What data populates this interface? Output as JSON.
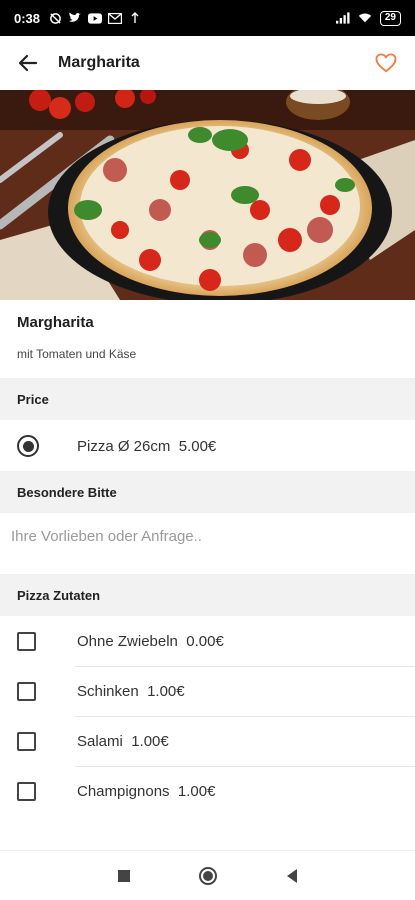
{
  "status_bar": {
    "time": "0:38",
    "battery": "29"
  },
  "app_bar": {
    "title": "Margharita"
  },
  "product": {
    "name": "Margharita",
    "description": "mit Tomaten und Käse"
  },
  "price_section": {
    "title": "Price",
    "option": {
      "label": "Pizza Ø 26cm",
      "price": "5.00€",
      "selected": true
    }
  },
  "request_section": {
    "title": "Besondere Bitte",
    "placeholder": "Ihre Vorlieben oder Anfrage.."
  },
  "toppings_section": {
    "title": "Pizza Zutaten",
    "items": [
      {
        "label": "Ohne Zwiebeln",
        "price": "0.00€",
        "checked": false
      },
      {
        "label": "Schinken",
        "price": "1.00€",
        "checked": false
      },
      {
        "label": "Salami",
        "price": "1.00€",
        "checked": false
      },
      {
        "label": "Champignons",
        "price": "1.00€",
        "checked": false
      }
    ]
  },
  "colors": {
    "accent": "#f07a3a",
    "section_bg": "#f2f2f2",
    "status_bar": "#000000"
  }
}
